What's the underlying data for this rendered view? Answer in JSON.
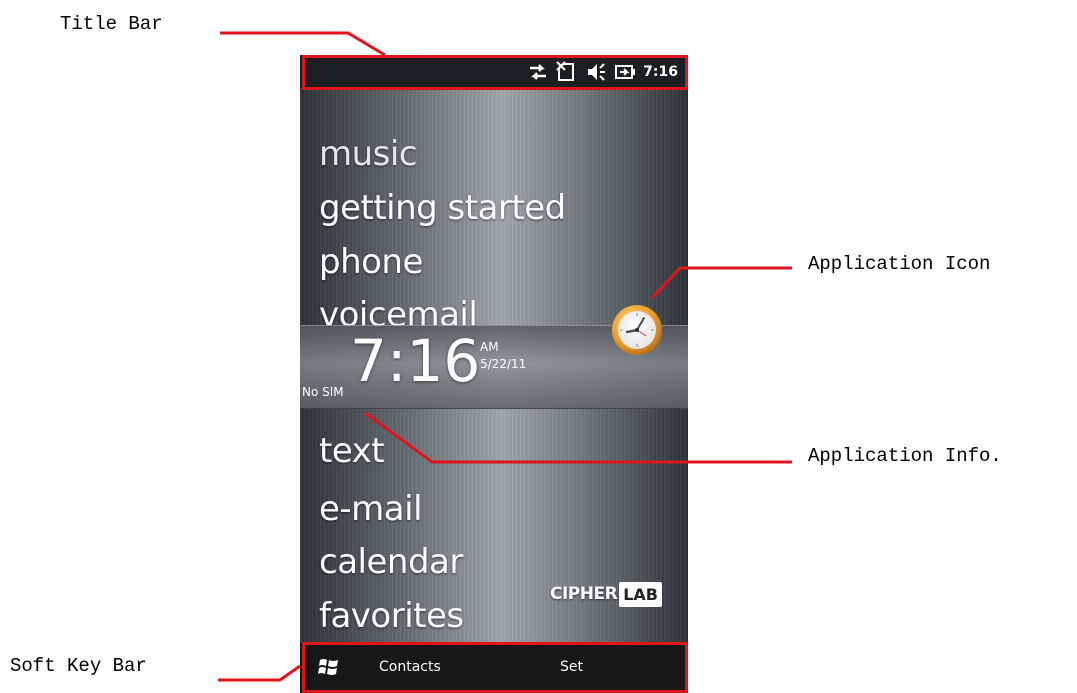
{
  "callouts": {
    "title_bar": "Title Bar",
    "soft_key_bar": "Soft Key Bar",
    "application_icon": "Application Icon",
    "application_info": "Application Info."
  },
  "title_bar": {
    "clock": "7:16",
    "icons": [
      "data-connection-icon",
      "no-sim-icon",
      "sound-muted-icon",
      "battery-charging-icon"
    ]
  },
  "menu": {
    "items": [
      {
        "label": "music"
      },
      {
        "label": "getting started"
      },
      {
        "label": "phone"
      },
      {
        "label": "voicemail"
      },
      {
        "label": "text"
      },
      {
        "label": "e-mail"
      },
      {
        "label": "calendar"
      },
      {
        "label": "favorites"
      }
    ]
  },
  "clock_widget": {
    "time": "7:16",
    "ampm": "AM",
    "date": "5/22/11",
    "sim_status": "No SIM"
  },
  "brand": {
    "part1": "CIPHER",
    "part2": "LAB"
  },
  "soft_keys": {
    "start_icon": "windows-flag-icon",
    "left": "Contacts",
    "right": "Set"
  },
  "colors": {
    "highlight": "#e1141b",
    "title_bar_bg": "#1c1f22",
    "soft_key_bg": "#151719",
    "clock_icon": "#f0a030"
  }
}
